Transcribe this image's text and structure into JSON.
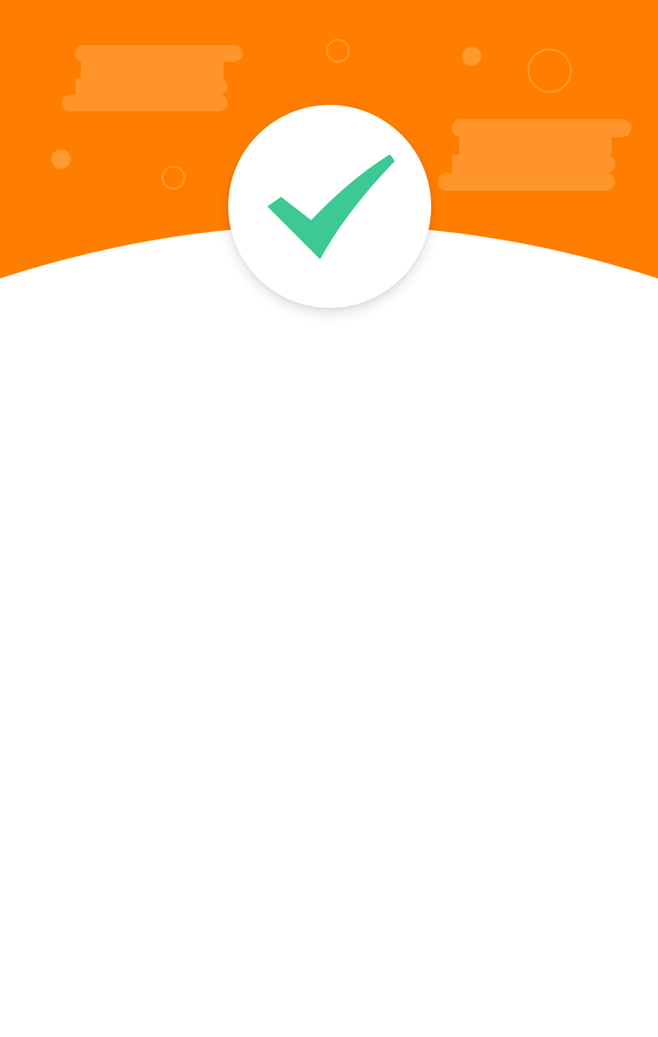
{
  "colors": {
    "header_orange": "#FF7E00",
    "decoration_light": "#FF9A33",
    "check_green": "#3CC994",
    "background": "#FFFFFF"
  },
  "icons": {
    "badge": "checkmark-icon",
    "decorations": [
      "cloud-shape",
      "cloud-shape",
      "ring-shape",
      "dot-shape"
    ]
  }
}
